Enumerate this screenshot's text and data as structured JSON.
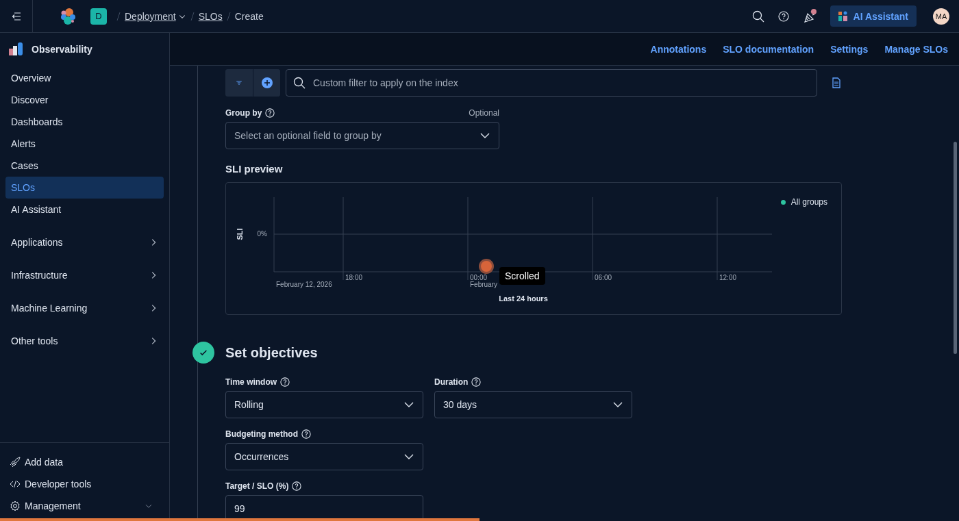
{
  "header": {
    "deployment_badge": "D",
    "breadcrumbs": [
      {
        "label": "Deployment",
        "link": true,
        "dropdown": true
      },
      {
        "label": "SLOs",
        "link": true,
        "dropdown": false
      },
      {
        "label": "Create",
        "link": false,
        "dropdown": false
      }
    ],
    "notification_dot": true,
    "ai_button": "AI Assistant",
    "avatar": "MA"
  },
  "sidebar": {
    "title": "Observability",
    "items": [
      {
        "label": "Overview",
        "kind": "link",
        "selected": false
      },
      {
        "label": "Discover",
        "kind": "link",
        "selected": false
      },
      {
        "label": "Dashboards",
        "kind": "link",
        "selected": false
      },
      {
        "label": "Alerts",
        "kind": "link",
        "selected": false
      },
      {
        "label": "Cases",
        "kind": "link",
        "selected": false
      },
      {
        "label": "SLOs",
        "kind": "link",
        "selected": true
      },
      {
        "label": "AI Assistant",
        "kind": "link",
        "selected": false
      },
      {
        "label": "Applications",
        "kind": "group",
        "selected": false
      },
      {
        "label": "Infrastructure",
        "kind": "group",
        "selected": false
      },
      {
        "label": "Machine Learning",
        "kind": "group",
        "selected": false
      },
      {
        "label": "Other tools",
        "kind": "group",
        "selected": false
      }
    ],
    "footer": [
      {
        "label": "Add data",
        "kind": "rocket"
      },
      {
        "label": "Developer tools",
        "kind": "code"
      },
      {
        "label": "Management",
        "kind": "gear",
        "expandable": true
      }
    ]
  },
  "subheader_links": [
    "Annotations",
    "SLO documentation",
    "Settings",
    "Manage SLOs"
  ],
  "filter": {
    "placeholder": "Custom filter to apply on the index"
  },
  "group_by": {
    "label": "Group by",
    "hint": "Optional",
    "placeholder": "Select an optional field to group by"
  },
  "sli_preview": {
    "title": "SLI preview",
    "y_title": "SLI",
    "y_ticks": [
      "0%"
    ],
    "x_ticks": [
      "18:00",
      "00:00",
      "06:00",
      "12:00"
    ],
    "x_dates": [
      "February 12, 2026",
      "February"
    ],
    "x_title": "Last 24 hours",
    "legend": [
      {
        "label": "All groups",
        "color": "#2ec4a0"
      }
    ]
  },
  "tooltip": "Scrolled",
  "objectives": {
    "title": "Set objectives",
    "done": true,
    "fields": [
      {
        "label": "Time window",
        "value": "Rolling",
        "kind": "select"
      },
      {
        "label": "Duration",
        "value": "30 days",
        "kind": "select"
      },
      {
        "label": "Budgeting method",
        "value": "Occurrences",
        "kind": "select"
      },
      {
        "label": "Target / SLO (%)",
        "value": "99",
        "kind": "input"
      }
    ]
  },
  "progress": {
    "level": 0.5
  }
}
